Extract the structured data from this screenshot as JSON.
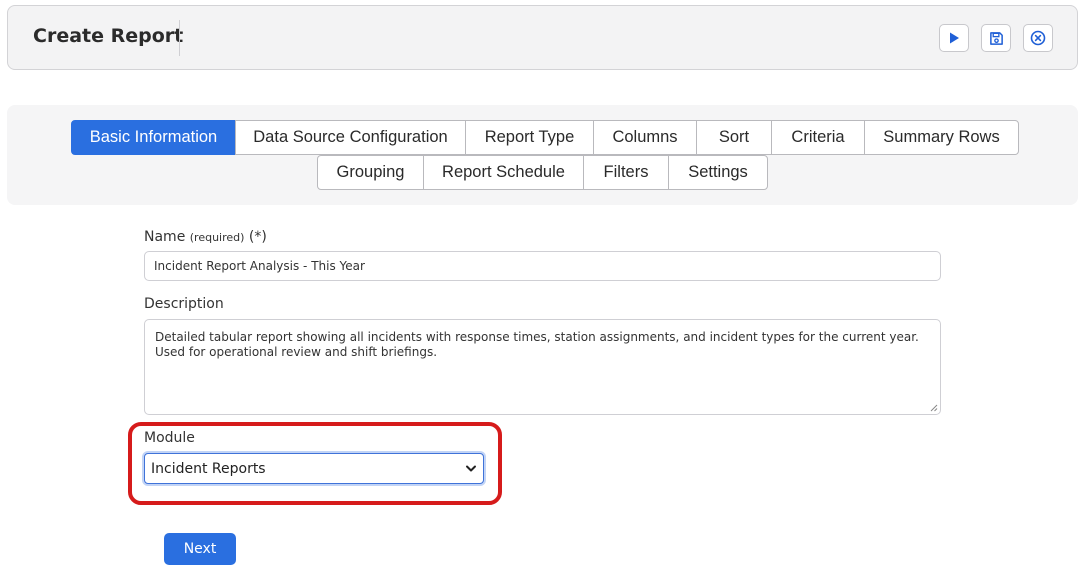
{
  "header": {
    "title": "Create Report",
    "buttons": [
      {
        "name": "run-button",
        "icon": "play-icon"
      },
      {
        "name": "save-button",
        "icon": "floppy-disk-icon"
      },
      {
        "name": "close-button",
        "icon": "circle-x-icon"
      }
    ]
  },
  "tabs": {
    "row1": [
      "Basic Information",
      "Data Source Configuration",
      "Report Type",
      "Columns",
      "Sort",
      "Criteria",
      "Summary Rows"
    ],
    "row2": [
      "Grouping",
      "Report Schedule",
      "Filters",
      "Settings"
    ],
    "active": "Basic Information"
  },
  "form": {
    "name_label": "Name",
    "name_required": "(required)",
    "name_asterisk": "(*)",
    "name_value": "Incident Report Analysis - This Year",
    "description_label": "Description",
    "description_value": "Detailed tabular report showing all incidents with response times, station assignments, and incident types for the current year. Used for operational review and shift briefings.",
    "module_label": "Module",
    "module_value": "Incident Reports"
  },
  "actions": {
    "next_label": "Next"
  },
  "colors": {
    "accent": "#2a6fe0",
    "highlight": "#d61b1b"
  }
}
